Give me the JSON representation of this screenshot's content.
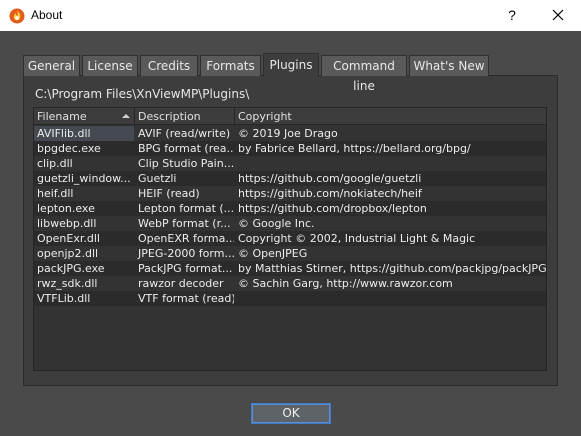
{
  "window": {
    "title": "About",
    "help_label": "?",
    "close_icon": "close-icon",
    "app_icon": "xnview-flame-icon"
  },
  "tabs": [
    {
      "label": "General"
    },
    {
      "label": "License"
    },
    {
      "label": "Credits"
    },
    {
      "label": "Formats"
    },
    {
      "label": "Plugins",
      "active": true
    },
    {
      "label": "Command line"
    },
    {
      "label": "What's New"
    }
  ],
  "plugins": {
    "path": "C:\\Program Files\\XnViewMP\\Plugins\\",
    "columns": [
      "Filename",
      "Description",
      "Copyright"
    ],
    "sort_column": "Filename",
    "sort_order": "ascending",
    "rows": [
      {
        "filename": "AVIFlib.dll",
        "description": "AVIF (read/write)",
        "copyright": "© 2019 Joe Drago"
      },
      {
        "filename": "bpgdec.exe",
        "description": "BPG format (rea...",
        "copyright": "by Fabrice Bellard, https://bellard.org/bpg/"
      },
      {
        "filename": "clip.dll",
        "description": "Clip Studio Pain...",
        "copyright": ""
      },
      {
        "filename": "guetzli_window...",
        "description": "Guetzli",
        "copyright": "https://github.com/google/guetzli"
      },
      {
        "filename": "heif.dll",
        "description": "HEIF (read)",
        "copyright": "https://github.com/nokiatech/heif"
      },
      {
        "filename": "lepton.exe",
        "description": "Lepton format (...",
        "copyright": "https://github.com/dropbox/lepton"
      },
      {
        "filename": "libwebp.dll",
        "description": "WebP format (r...",
        "copyright": "© Google Inc."
      },
      {
        "filename": "OpenExr.dll",
        "description": "OpenEXR forma...",
        "copyright": "Copyright © 2002, Industrial Light & Magic"
      },
      {
        "filename": "openjp2.dll",
        "description": "JPEG-2000 form...",
        "copyright": "© OpenJPEG"
      },
      {
        "filename": "packJPG.exe",
        "description": "PackJPG format...",
        "copyright": "by Matthias Stirner, https://github.com/packjpg/packJPG"
      },
      {
        "filename": "rwz_sdk.dll",
        "description": "rawzor decoder",
        "copyright": "© Sachin Garg, http://www.rawzor.com"
      },
      {
        "filename": "VTFLib.dll",
        "description": "VTF format (read)",
        "copyright": ""
      }
    ]
  },
  "footer": {
    "ok_label": "OK"
  },
  "colors": {
    "background": "#4a4a4a",
    "panel": "#3d3d3d",
    "accent": "#3f7bc8"
  }
}
